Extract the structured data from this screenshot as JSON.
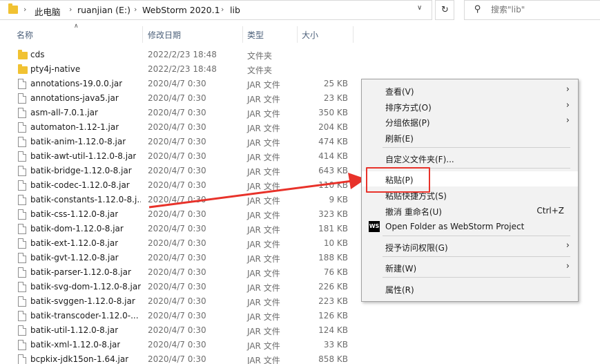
{
  "address": {
    "crumbs": [
      "此电脑",
      "ruanjian (E:)",
      "WebStorm 2020.1",
      "lib"
    ],
    "search_placeholder": "搜索\"lib\""
  },
  "columns": {
    "name": "名称",
    "date": "修改日期",
    "type": "类型",
    "size": "大小"
  },
  "files": [
    {
      "name": "cds",
      "date": "2022/2/23 18:48",
      "type": "文件夹",
      "size": "",
      "kind": "folder"
    },
    {
      "name": "pty4j-native",
      "date": "2022/2/23 18:48",
      "type": "文件夹",
      "size": "",
      "kind": "folder"
    },
    {
      "name": "annotations-19.0.0.jar",
      "date": "2020/4/7 0:30",
      "type": "JAR 文件",
      "size": "25 KB",
      "kind": "file"
    },
    {
      "name": "annotations-java5.jar",
      "date": "2020/4/7 0:30",
      "type": "JAR 文件",
      "size": "23 KB",
      "kind": "file"
    },
    {
      "name": "asm-all-7.0.1.jar",
      "date": "2020/4/7 0:30",
      "type": "JAR 文件",
      "size": "350 KB",
      "kind": "file"
    },
    {
      "name": "automaton-1.12-1.jar",
      "date": "2020/4/7 0:30",
      "type": "JAR 文件",
      "size": "204 KB",
      "kind": "file"
    },
    {
      "name": "batik-anim-1.12.0-8.jar",
      "date": "2020/4/7 0:30",
      "type": "JAR 文件",
      "size": "474 KB",
      "kind": "file"
    },
    {
      "name": "batik-awt-util-1.12.0-8.jar",
      "date": "2020/4/7 0:30",
      "type": "JAR 文件",
      "size": "414 KB",
      "kind": "file"
    },
    {
      "name": "batik-bridge-1.12.0-8.jar",
      "date": "2020/4/7 0:30",
      "type": "JAR 文件",
      "size": "643 KB",
      "kind": "file"
    },
    {
      "name": "batik-codec-1.12.0-8.jar",
      "date": "2020/4/7 0:30",
      "type": "JAR 文件",
      "size": "110 KB",
      "kind": "file"
    },
    {
      "name": "batik-constants-1.12.0-8.j...",
      "date": "2020/4/7 0:30",
      "type": "JAR 文件",
      "size": "9 KB",
      "kind": "file"
    },
    {
      "name": "batik-css-1.12.0-8.jar",
      "date": "2020/4/7 0:30",
      "type": "JAR 文件",
      "size": "323 KB",
      "kind": "file"
    },
    {
      "name": "batik-dom-1.12.0-8.jar",
      "date": "2020/4/7 0:30",
      "type": "JAR 文件",
      "size": "181 KB",
      "kind": "file"
    },
    {
      "name": "batik-ext-1.12.0-8.jar",
      "date": "2020/4/7 0:30",
      "type": "JAR 文件",
      "size": "10 KB",
      "kind": "file"
    },
    {
      "name": "batik-gvt-1.12.0-8.jar",
      "date": "2020/4/7 0:30",
      "type": "JAR 文件",
      "size": "188 KB",
      "kind": "file"
    },
    {
      "name": "batik-parser-1.12.0-8.jar",
      "date": "2020/4/7 0:30",
      "type": "JAR 文件",
      "size": "76 KB",
      "kind": "file"
    },
    {
      "name": "batik-svg-dom-1.12.0-8.jar",
      "date": "2020/4/7 0:30",
      "type": "JAR 文件",
      "size": "226 KB",
      "kind": "file"
    },
    {
      "name": "batik-svggen-1.12.0-8.jar",
      "date": "2020/4/7 0:30",
      "type": "JAR 文件",
      "size": "223 KB",
      "kind": "file"
    },
    {
      "name": "batik-transcoder-1.12.0-...",
      "date": "2020/4/7 0:30",
      "type": "JAR 文件",
      "size": "126 KB",
      "kind": "file"
    },
    {
      "name": "batik-util-1.12.0-8.jar",
      "date": "2020/4/7 0:30",
      "type": "JAR 文件",
      "size": "124 KB",
      "kind": "file"
    },
    {
      "name": "batik-xml-1.12.0-8.jar",
      "date": "2020/4/7 0:30",
      "type": "JAR 文件",
      "size": "33 KB",
      "kind": "file"
    },
    {
      "name": "bcpkix-jdk15on-1.64.jar",
      "date": "2020/4/7 0:30",
      "type": "JAR 文件",
      "size": "858 KB",
      "kind": "file"
    }
  ],
  "menu": {
    "view": "查看(V)",
    "sort": "排序方式(O)",
    "group": "分组依据(P)",
    "refresh": "刷新(E)",
    "customize": "自定义文件夹(F)...",
    "paste": "粘贴(P)",
    "paste_shortcut": "粘贴快捷方式(S)",
    "undo": "撤消 重命名(U)",
    "undo_shortcut": "Ctrl+Z",
    "webstorm": "Open Folder as WebStorm Project",
    "webstorm_icon_text": "WS",
    "access": "授予访问权限(G)",
    "new": "新建(W)",
    "properties": "属性(R)"
  },
  "colors": {
    "highlight": "#e8322a",
    "folder": "#f1c232"
  }
}
